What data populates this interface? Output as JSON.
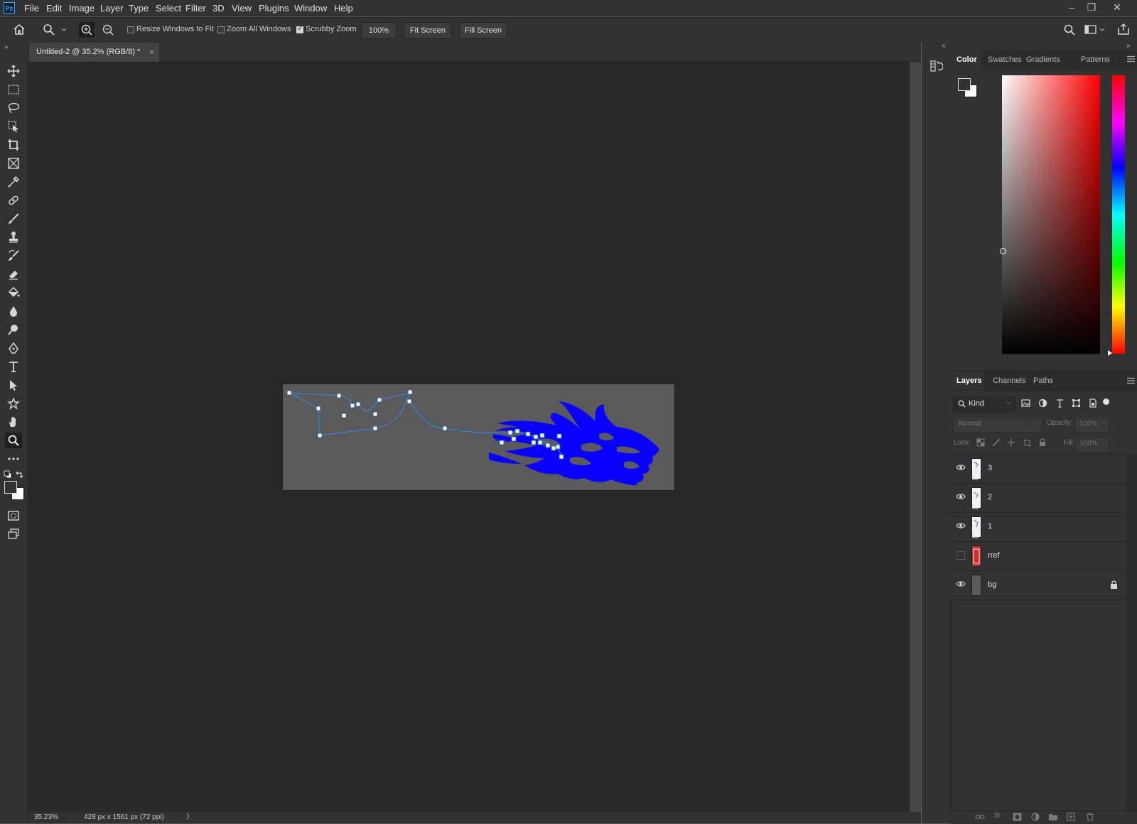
{
  "menubar": {
    "logo": "Ps",
    "items": [
      "File",
      "Edit",
      "Image",
      "Layer",
      "Type",
      "Select",
      "Filter",
      "3D",
      "View",
      "Plugins",
      "Window",
      "Help"
    ],
    "window_controls": {
      "minimize": "–",
      "restore": "❐",
      "close": "✕"
    }
  },
  "options": {
    "resize_windows_label": "Resize Windows to Fit",
    "resize_windows_checked": false,
    "zoom_all_label": "Zoom All Windows",
    "zoom_all_checked": false,
    "scrubby_label": "Scrubby Zoom",
    "scrubby_checked": true,
    "zoom_100_label": "100%",
    "fit_screen_label": "Fit Screen",
    "fill_screen_label": "Fill Screen"
  },
  "document": {
    "tab_title": "Untitled-2 @ 35.2% (RGB/8) *",
    "tab_close": "×"
  },
  "status": {
    "zoom": "35.23%",
    "doc_info": "428 px x 1561 px (72 ppi)",
    "arrow": "〉"
  },
  "color_panel": {
    "tabs": [
      "Color",
      "Swatches",
      "Gradients",
      "Patterns"
    ],
    "active_tab": "Color",
    "hue_color": "#ff0000"
  },
  "layers_panel": {
    "tabs": [
      "Layers",
      "Channels",
      "Paths"
    ],
    "active_tab": "Layers",
    "filter_label": "Kind",
    "blend_mode": "Normal",
    "opacity_label": "Opacity:",
    "opacity_value": "100%",
    "lock_label": "Lock:",
    "fill_label": "Fill:",
    "fill_value": "100%",
    "layers": [
      {
        "name": "3",
        "visible": true,
        "locked": false
      },
      {
        "name": "2",
        "visible": true,
        "locked": false
      },
      {
        "name": "1",
        "visible": true,
        "locked": false
      },
      {
        "name": "rref",
        "visible": false,
        "locked": false
      },
      {
        "name": "bg",
        "visible": true,
        "locked": true
      }
    ]
  },
  "colors": {
    "artwork_fill": "#0a00ff",
    "path_stroke": "#3d7fd1",
    "accent": "#31a8ff"
  }
}
